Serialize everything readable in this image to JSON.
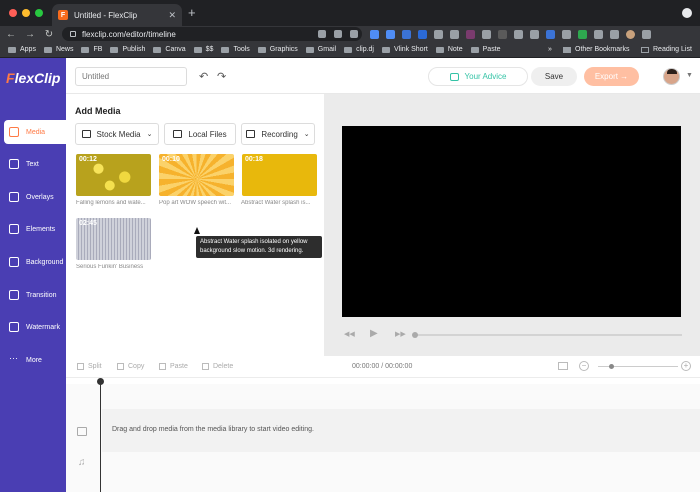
{
  "browser": {
    "tab_title": "Untitled - FlexClip",
    "tab_favicon": "F",
    "url": "flexclip.com/editor/timeline",
    "bookmarks": [
      "Apps",
      "News",
      "FB",
      "Publish",
      "Canva",
      "$$",
      "Tools",
      "Graphics",
      "Gmail",
      "clip.dj",
      "Vlink Short",
      "Note",
      "Paste"
    ],
    "bookmarks_overflow": "»",
    "other_bookmarks": "Other Bookmarks",
    "reading_list": "Reading List"
  },
  "app": {
    "logo": "lexClip",
    "logo_f": "F",
    "project_name_placeholder": "Untitled",
    "undo": "↶",
    "redo": "↷",
    "advice_label": "Your Advice",
    "save_label": "Save",
    "export_label": "Export →"
  },
  "sidebar": {
    "items": [
      {
        "label": "Media",
        "icon": "media-icon"
      },
      {
        "label": "Text",
        "icon": "text-icon"
      },
      {
        "label": "Overlays",
        "icon": "overlays-icon"
      },
      {
        "label": "Elements",
        "icon": "elements-icon"
      },
      {
        "label": "Background",
        "icon": "background-icon"
      },
      {
        "label": "Transition",
        "icon": "transition-icon"
      },
      {
        "label": "Watermark",
        "icon": "watermark-icon"
      },
      {
        "label": "More",
        "icon": "more-icon"
      }
    ]
  },
  "media": {
    "title": "Add Media",
    "stock_label": "Stock Media",
    "local_label": "Local Files",
    "recording_label": "Recording",
    "items": [
      {
        "duration": "00:12",
        "caption": "Falling lemons and wate..."
      },
      {
        "duration": "00:10",
        "caption": "Pop art WOW speech wit..."
      },
      {
        "duration": "00:18",
        "caption": "Abstract Water splash is..."
      },
      {
        "duration": "02:45",
        "caption": "Serious Funkin' Business"
      }
    ],
    "tooltip": "Abstract Water splash isolated on yellow background slow motion. 3d rendering."
  },
  "player": {
    "rewind": "◀◀",
    "play": "▶",
    "forward": "▶▶",
    "progress": 0
  },
  "timeline": {
    "split": "Split",
    "copy": "Copy",
    "paste": "Paste",
    "delete": "Delete",
    "timecode": "00:00:00 / 00:00:00",
    "zoom_out": "−",
    "zoom_in": "+",
    "drop_hint": "Drag and drop media from the media library to start video editing."
  },
  "colors": {
    "sidebar": "#4a3eb3",
    "accent": "#ff7a45",
    "advice": "#34c3a6"
  }
}
